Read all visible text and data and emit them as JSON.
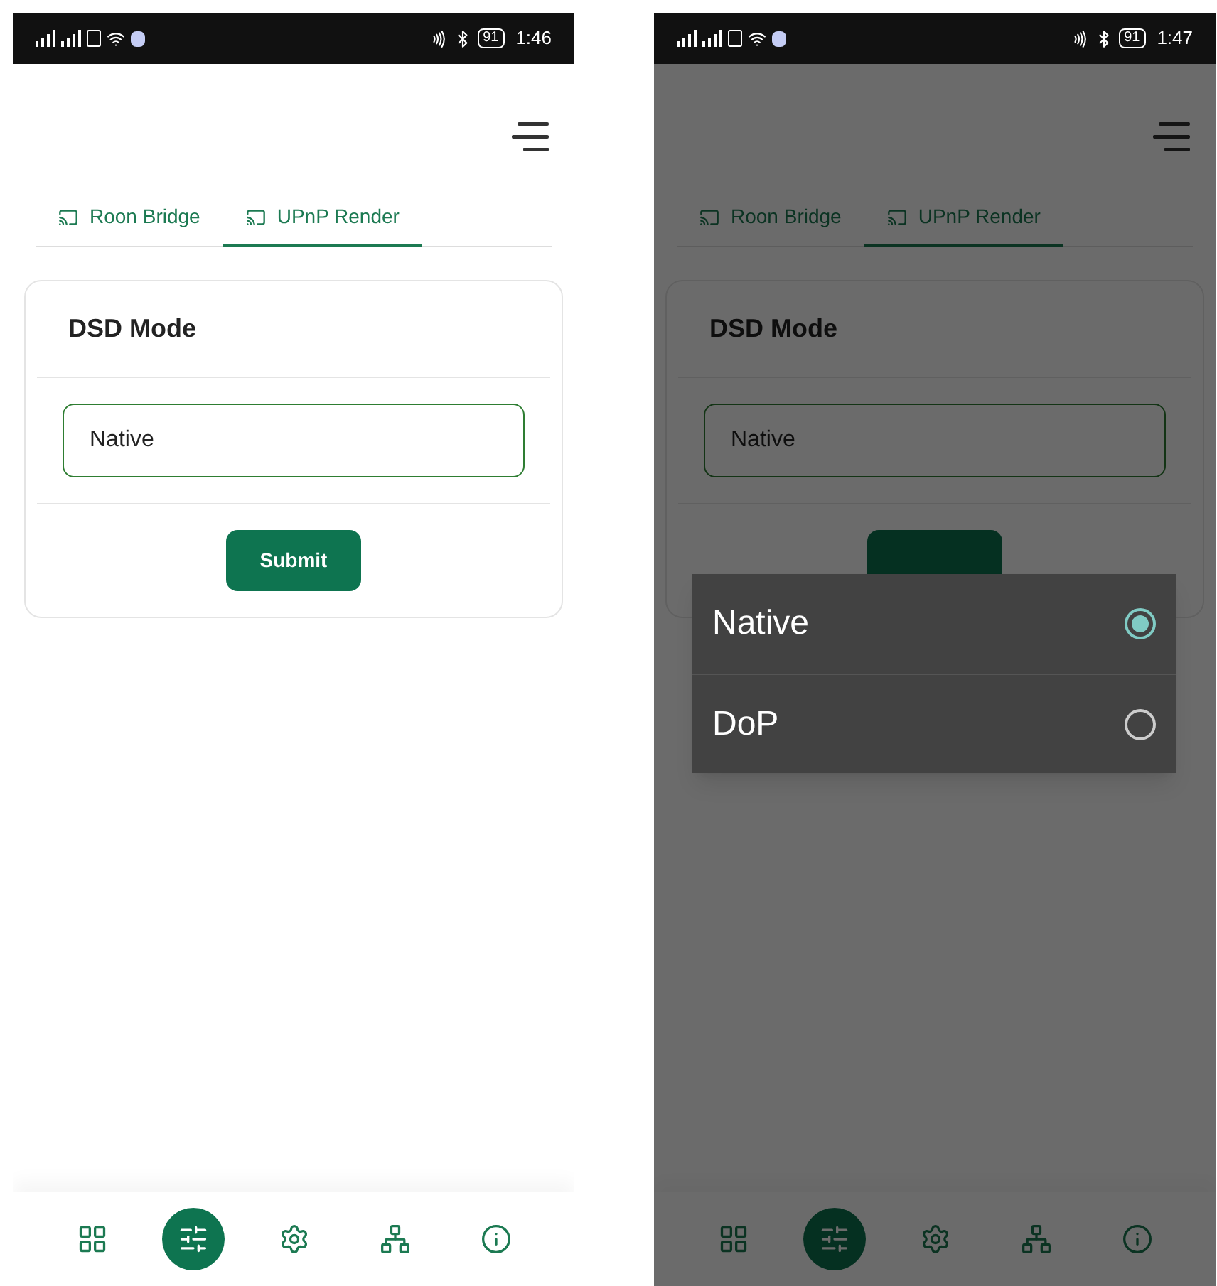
{
  "screens": [
    {
      "status_bar": {
        "battery": "91",
        "time": "1:46"
      },
      "tabs": [
        {
          "label": "Roon Bridge",
          "selected": false
        },
        {
          "label": "UPnP Render",
          "selected": true
        }
      ],
      "card": {
        "title": "DSD Mode",
        "field_value": "Native",
        "submit": "Submit"
      },
      "nav": [
        {
          "kind": "grid",
          "selected": false
        },
        {
          "kind": "sliders",
          "selected": true
        },
        {
          "kind": "gear",
          "selected": false
        },
        {
          "kind": "network",
          "selected": false
        },
        {
          "kind": "info",
          "selected": false
        }
      ]
    },
    {
      "status_bar": {
        "battery": "91",
        "time": "1:47"
      },
      "tabs": [
        {
          "label": "Roon Bridge",
          "selected": false
        },
        {
          "label": "UPnP Render",
          "selected": true
        }
      ],
      "card": {
        "title": "DSD Mode",
        "field_value": "Native"
      },
      "nav": [
        {
          "kind": "grid",
          "selected": false
        },
        {
          "kind": "sliders",
          "selected": true
        },
        {
          "kind": "gear",
          "selected": false
        },
        {
          "kind": "network",
          "selected": false
        },
        {
          "kind": "info",
          "selected": false
        }
      ],
      "dialog": {
        "options": [
          {
            "label": "Native",
            "selected": true
          },
          {
            "label": "DoP",
            "selected": false
          }
        ]
      }
    }
  ]
}
